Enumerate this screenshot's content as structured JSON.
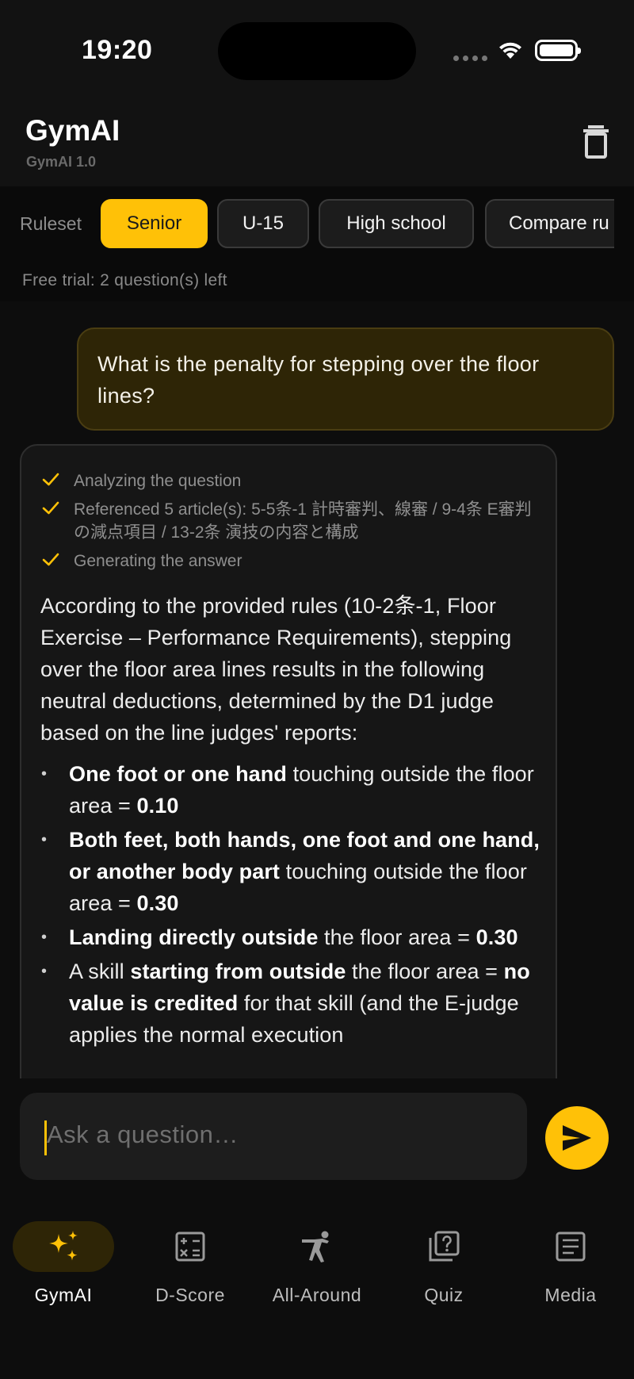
{
  "status_bar": {
    "time": "19:20"
  },
  "header": {
    "title": "GymAI",
    "version": "GymAI 1.0",
    "trash_icon": "trash-icon"
  },
  "ruleset": {
    "label": "Ruleset",
    "chips": [
      {
        "label": "Senior",
        "active": true
      },
      {
        "label": "U-15",
        "active": false
      },
      {
        "label": "High school",
        "active": false
      },
      {
        "label": "Compare ru",
        "active": false
      }
    ],
    "trial_text": "Free trial: 2 question(s) left"
  },
  "chat": {
    "user_message": "What is the penalty for stepping over the floor lines?",
    "steps": [
      {
        "text": "Analyzing the question",
        "icon": "check-icon"
      },
      {
        "text": "Referenced 5 article(s): 5-5条-1 計時審判、線審 / 9-4条 E審判の減点項目 / 13-2条 演技の内容と構成",
        "icon": "check-icon"
      },
      {
        "text": "Generating the answer",
        "icon": "check-icon"
      }
    ],
    "answer_intro": "According to the provided rules (10-2条-1, Floor Exercise – Performance Requirements), stepping over the floor area lines results in the following neutral deductions, determined by the D1 judge based on the line judges' reports:",
    "bullets": [
      {
        "bold": "One foot or one hand",
        "text": " touching outside the floor area = ",
        "value": "0.10",
        "tail": ""
      },
      {
        "bold": "Both feet, both hands, one foot and one hand, or another body part",
        "text": " touching outside the floor area = ",
        "value": "0.30",
        "tail": ""
      },
      {
        "bold": "Landing directly outside",
        "text": " the floor area = ",
        "value": "0.30",
        "tail": ""
      },
      {
        "prefix": "A skill ",
        "bold": "starting from outside",
        "text": " the floor area = ",
        "value": "no value is credited",
        "tail": " for that skill (and the E-judge applies the normal execution"
      }
    ]
  },
  "input": {
    "placeholder": "Ask a question…",
    "send_icon": "send-icon"
  },
  "nav": [
    {
      "label": "GymAI",
      "icon": "sparkles-icon",
      "active": true
    },
    {
      "label": "D-Score",
      "icon": "calculator-icon",
      "active": false
    },
    {
      "label": "All-Around",
      "icon": "gymnast-icon",
      "active": false
    },
    {
      "label": "Quiz",
      "icon": "quiz-icon",
      "active": false
    },
    {
      "label": "Media",
      "icon": "article-icon",
      "active": false
    }
  ],
  "colors": {
    "accent": "#ffc107",
    "background": "#0d0d0d",
    "card": "#161616",
    "user_bubble": "#2e2506"
  }
}
